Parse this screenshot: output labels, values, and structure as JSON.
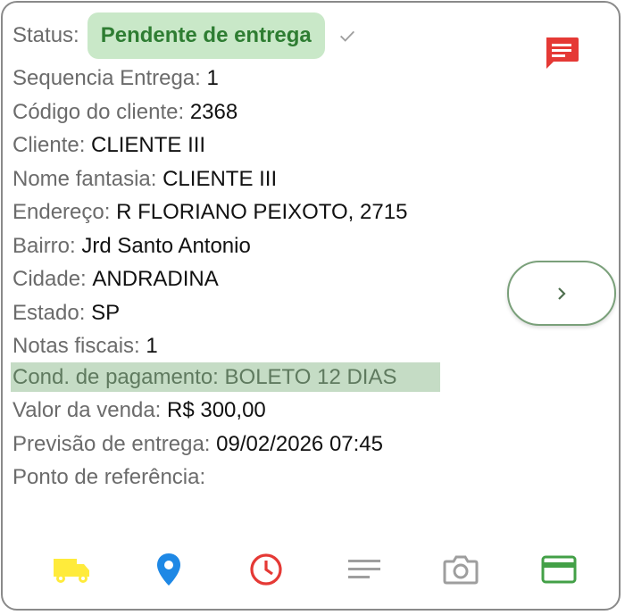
{
  "status": {
    "label": "Status:",
    "value": "Pendente de entrega"
  },
  "fields": [
    {
      "label": "Sequencia Entrega:",
      "value": "1"
    },
    {
      "label": "Código do cliente:",
      "value": "2368"
    },
    {
      "label": "Cliente:",
      "value": "CLIENTE III"
    },
    {
      "label": "Nome fantasia:",
      "value": "CLIENTE III"
    },
    {
      "label": "Endereço:",
      "value": "R FLORIANO PEIXOTO, 2715"
    },
    {
      "label": "Bairro:",
      "value": "Jrd Santo Antonio"
    },
    {
      "label": "Cidade:",
      "value": "ANDRADINA"
    },
    {
      "label": "Estado:",
      "value": "SP"
    },
    {
      "label": "Notas fiscais:",
      "value": "1"
    }
  ],
  "payment": {
    "label": "Cond. de pagamento:",
    "value": "BOLETO 12 DIAS"
  },
  "fields2": [
    {
      "label": "Valor da venda:",
      "value": "R$ 300,00"
    },
    {
      "label": "Previsão de entrega:",
      "value": "09/02/2026 07:45"
    },
    {
      "label": "Ponto de referência:",
      "value": ""
    }
  ],
  "icons": {
    "check": "check-icon",
    "chat": "chat-icon",
    "next": "chevron-right-icon",
    "toolbar": [
      "truck-icon",
      "location-pin-icon",
      "clock-icon",
      "notes-icon",
      "camera-icon",
      "credit-card-icon"
    ]
  },
  "colors": {
    "status_bg": "#c9e8c8",
    "status_text": "#2e7d32",
    "chat": "#e53935",
    "truck": "#ffeb3b",
    "pin": "#1e88e5",
    "clock": "#e53935",
    "notes": "#9e9e9e",
    "camera": "#9e9e9e",
    "card": "#43a047",
    "highlight": "#c5dcc5"
  }
}
